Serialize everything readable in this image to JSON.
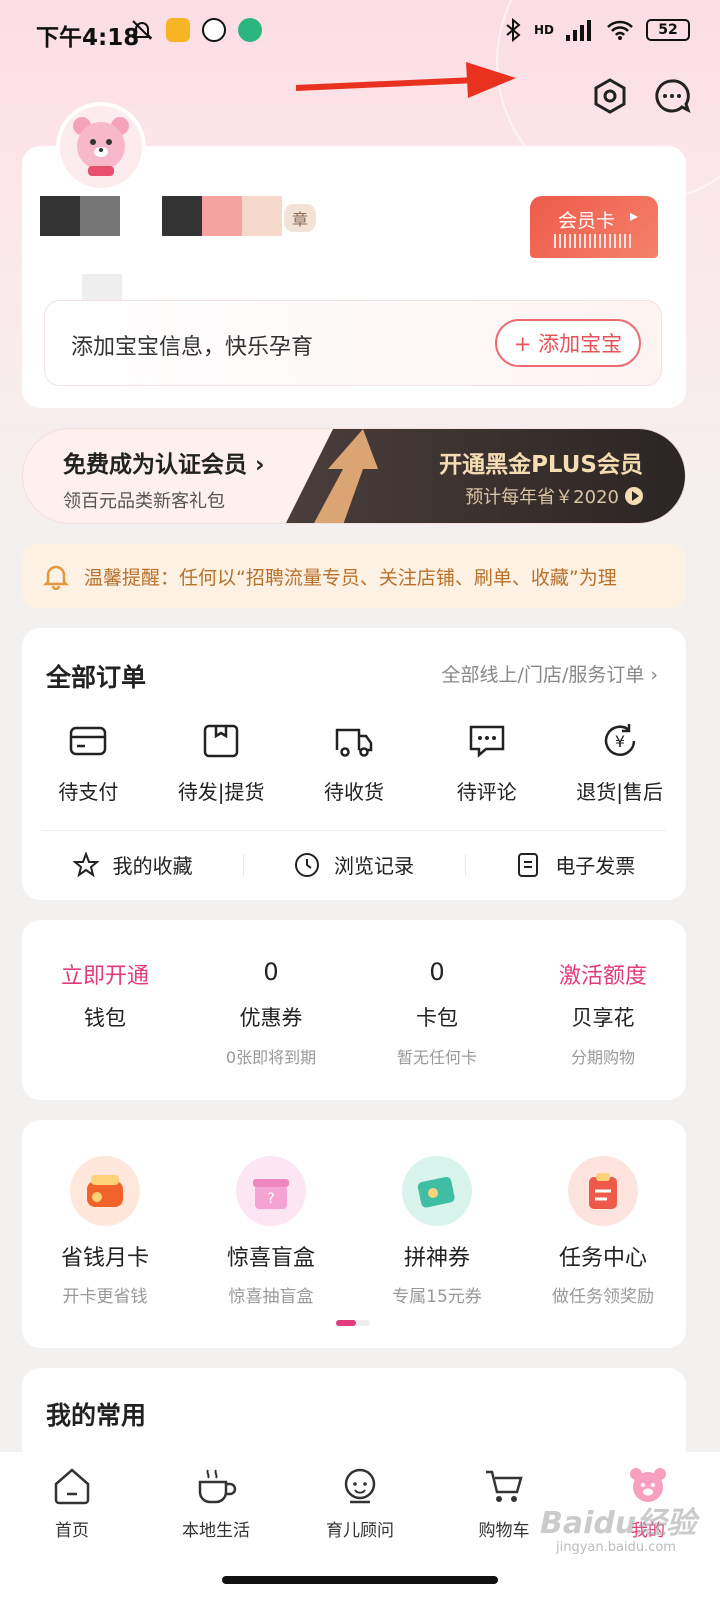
{
  "status_bar": {
    "time": "下午4:18",
    "network": "HD",
    "battery": "52"
  },
  "profile": {
    "badge_partial": "章",
    "member_card_label": "会员卡",
    "baby_prompt": "添加宝宝信息，快乐孕育",
    "add_baby_button": "+ 添加宝宝"
  },
  "vip_banner": {
    "left_title": "免费成为认证会员 ›",
    "left_sub": "领百元品类新客礼包",
    "right_title": "开通黑金PLUS会员",
    "right_sub": "预计每年省￥2020"
  },
  "notice": {
    "text": "温馨提醒：任何以“招聘流量专员、关注店铺、刷单、收藏”为理"
  },
  "orders": {
    "title": "全部订单",
    "more": "全部线上/门店/服务订单 ›",
    "items": [
      {
        "label": "待支付",
        "icon": "card-icon"
      },
      {
        "label": "待发|提货",
        "icon": "box-icon"
      },
      {
        "label": "待收货",
        "icon": "truck-icon"
      },
      {
        "label": "待评论",
        "icon": "comment-icon"
      },
      {
        "label": "退货|售后",
        "icon": "refund-icon"
      }
    ],
    "quick": [
      {
        "label": "我的收藏",
        "icon": "star-icon"
      },
      {
        "label": "浏览记录",
        "icon": "clock-icon"
      },
      {
        "label": "电子发票",
        "icon": "invoice-icon"
      }
    ]
  },
  "wallet": {
    "items": [
      {
        "value": "立即开通",
        "name": "钱包",
        "sub": ""
      },
      {
        "value": "0",
        "name": "优惠券",
        "sub": "0张即将到期"
      },
      {
        "value": "0",
        "name": "卡包",
        "sub": "暂无任何卡"
      },
      {
        "value": "激活额度",
        "name": "贝享花",
        "sub": "分期购物"
      }
    ]
  },
  "promo": {
    "items": [
      {
        "name": "省钱月卡",
        "sub": "开卡更省钱",
        "icon": "wallet-icon",
        "color": "#f0642b"
      },
      {
        "name": "惊喜盲盒",
        "sub": "惊喜抽盲盒",
        "icon": "gift-box-icon",
        "color": "#f5a3d2"
      },
      {
        "name": "拼神券",
        "sub": "专属15元券",
        "icon": "coupon-icon",
        "color": "#3fbea3"
      },
      {
        "name": "任务中心",
        "sub": "做任务领奖励",
        "icon": "task-icon",
        "color": "#ee5a4a"
      }
    ]
  },
  "common": {
    "title": "我的常用"
  },
  "tabbar": {
    "items": [
      {
        "label": "首页",
        "icon": "home-icon"
      },
      {
        "label": "本地生活",
        "icon": "coffee-icon"
      },
      {
        "label": "育儿顾问",
        "icon": "advisor-icon"
      },
      {
        "label": "购物车",
        "icon": "cart-icon"
      },
      {
        "label": "我的",
        "icon": "bear-icon"
      }
    ]
  },
  "watermark": {
    "main": "Baidu经验",
    "sub": "jingyan.baidu.com"
  },
  "colors": {
    "accent": "#e23b7b",
    "red": "#ee5a4a"
  }
}
